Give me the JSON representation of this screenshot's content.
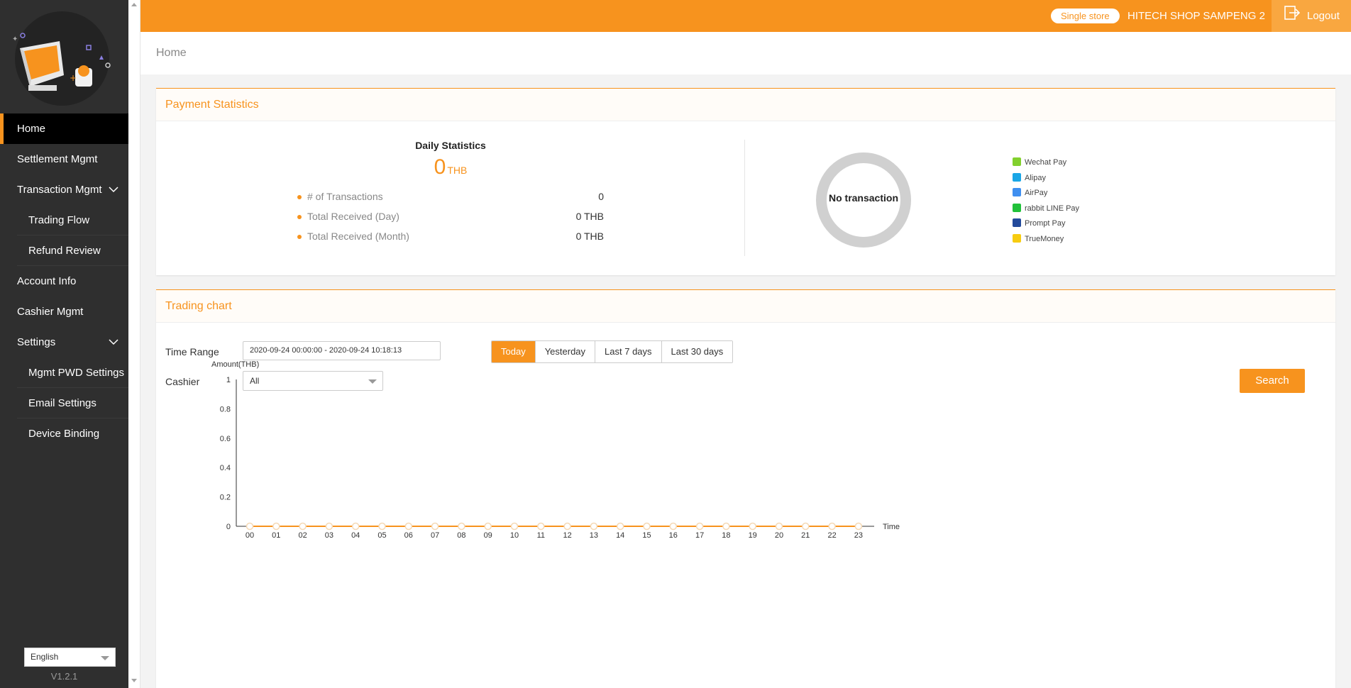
{
  "sidebar": {
    "items": [
      {
        "label": "Home"
      },
      {
        "label": "Settlement Mgmt"
      },
      {
        "label": "Transaction Mgmt"
      },
      {
        "label": "Trading Flow"
      },
      {
        "label": "Refund Review"
      },
      {
        "label": "Account Info"
      },
      {
        "label": "Cashier Mgmt"
      },
      {
        "label": "Settings"
      },
      {
        "label": "Mgmt PWD Settings"
      },
      {
        "label": "Email Settings"
      },
      {
        "label": "Device Binding"
      }
    ],
    "language": "English",
    "version": "V1.2.1"
  },
  "header": {
    "store_badge": "Single store",
    "store_name": "HITECH SHOP SAMPENG 2",
    "logout_label": "Logout"
  },
  "breadcrumb": "Home",
  "payment_stats": {
    "title": "Payment Statistics",
    "daily_title": "Daily Statistics",
    "daily_amount": "0",
    "currency": "THB",
    "rows": [
      {
        "label": "# of Transactions",
        "value": "0"
      },
      {
        "label": "Total Received (Day)",
        "value": "0 THB"
      },
      {
        "label": "Total Received (Month)",
        "value": "0 THB"
      }
    ],
    "donut_label": "No transaction",
    "legend": [
      {
        "name": "Wechat Pay",
        "color": "#82d02e"
      },
      {
        "name": "Alipay",
        "color": "#1aa6e6"
      },
      {
        "name": "AirPay",
        "color": "#3f8ff0"
      },
      {
        "name": "rabbit LINE Pay",
        "color": "#21c13a"
      },
      {
        "name": "Prompt Pay",
        "color": "#234a9b"
      },
      {
        "name": "TrueMoney",
        "color": "#f7cc11"
      }
    ]
  },
  "trading_chart": {
    "title": "Trading chart",
    "time_range_label": "Time Range",
    "time_range_value": "2020-09-24 00:00:00 - 2020-09-24 10:18:13",
    "cashier_label": "Cashier",
    "cashier_value": "All",
    "range_buttons": [
      "Today",
      "Yesterday",
      "Last 7 days",
      "Last 30 days"
    ],
    "active_range": "Today",
    "search_label": "Search"
  },
  "colors": {
    "accent": "#f7931e",
    "sidebar_bg": "#2f2f2f"
  },
  "chart_data": {
    "type": "line",
    "ylabel": "Amount(THB)",
    "xlabel": "Time",
    "ylim": [
      0,
      1
    ],
    "yticks": [
      "0",
      "0.2",
      "0.4",
      "0.6",
      "0.8",
      "1"
    ],
    "categories": [
      "00",
      "01",
      "02",
      "03",
      "04",
      "05",
      "06",
      "07",
      "08",
      "09",
      "10",
      "11",
      "12",
      "13",
      "14",
      "15",
      "16",
      "17",
      "18",
      "19",
      "20",
      "21",
      "22",
      "23"
    ],
    "values": [
      0,
      0,
      0,
      0,
      0,
      0,
      0,
      0,
      0,
      0,
      0,
      0,
      0,
      0,
      0,
      0,
      0,
      0,
      0,
      0,
      0,
      0,
      0,
      0
    ],
    "color": "#f7931e"
  }
}
